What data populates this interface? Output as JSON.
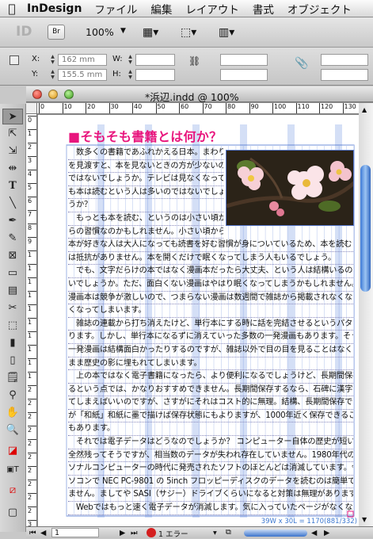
{
  "menubar": {
    "app": "InDesign",
    "items": [
      "ファイル",
      "編集",
      "レイアウト",
      "書式",
      "オブジェクト"
    ]
  },
  "appbar": {
    "br_label": "Br",
    "zoom": "100%"
  },
  "control": {
    "x_label": "X:",
    "x_value": "162 mm",
    "y_label": "Y:",
    "y_value": "155.5 mm",
    "w_label": "W:",
    "h_label": "H:"
  },
  "window": {
    "title": "*浜辺.indd @ 100%"
  },
  "rulers": {
    "h": [
      "0",
      "10",
      "20",
      "30",
      "40",
      "50",
      "60",
      "70",
      "80",
      "90",
      "100",
      "110",
      "120",
      "130"
    ],
    "v": [
      "0",
      "1",
      "2",
      "3",
      "4",
      "5",
      "6",
      "7",
      "8",
      "9",
      "1",
      "1",
      "1",
      "1",
      "1",
      "1",
      "1",
      "1",
      "1",
      "1",
      "2",
      "2",
      "2",
      "2",
      "2",
      "2",
      "2",
      "2",
      "2",
      "2",
      "3"
    ]
  },
  "doc": {
    "heading": "■そもそも書籍とは何か？",
    "lines": [
      "　数多くの書籍であふれかえる日本。まわり",
      "を見渡すと、本を見ないときの方が少ないの",
      "ではないでしょうか。テレビは見なくなって",
      "も本は読むという人は多いのではないでしょ",
      "うか？",
      "　もっとも本を読む、というのは小さい頃か",
      "らの習慣なのかもしれません。小さい頃から",
      "本が好きな人は大人になっても読書を好む習慣が身についているため、本を読むことに",
      "は抵抗がありません。本を開くだけで眠くなってしまう人もいるでしょう。",
      "　でも、文字だらけの本ではなく漫画本だったら大丈夫、という人は結構いるのではな",
      "いでしょうか。ただ、面白くない漫画はやはり眠くなってしまうかもしれません。他社",
      "漫画本は競争が激しいので、つまらない漫画は数週間で雑誌から掲載されなくなってな",
      "くなってしまいます。",
      "　雑誌の連載から打ち消えたけど、単行本にする時に話を完結させるというパターンもあ",
      "ります。しかし、単行本になるずに消えていった多数の一発漫画もあります。そういう",
      "一発漫画は結構面白かったりするのですが、雑誌以外で目の目を見ることはなく、その",
      "まま歴史の影に埋もれてしまいます。",
      "　上の本ではなく電子書籍になったら、より便利になるでしょうけど、長期間保存す",
      "るという点では、かなりおすすめできません。長期間保存するなら、石碑に漢字を描い",
      "てしまえばいいのですが、さすがにそれはコスト的に無理。結構、長期間保存できるの",
      "が「和紙」和紙に墨で描けば保存状態にもよりますが、1000年近く保存できることに",
      "もあります。",
      "　それでは電子データはどうなのでしょうか？ コンピューター自体の歴史が短いので",
      "全然残ってそうですが、相当数のデータが失われ存在していません。1980年代のパー",
      "ソナルコンピューターの時代に発売されたソフトのほとんどは消滅しています。今のパ",
      "ソコンで NEC PC-9801 の 5inch フロッピーディスクのデータを読むのは簡単ではあり",
      "ません。ましてや SASI（サジー）ドライブくらいになると対策は無理があります。",
      "　Webではもっと速く電子データが消滅します。気に入っていたページがなくなって"
    ],
    "counter": "39W x 30L = 1170(881/332)"
  },
  "statusbar": {
    "page": "1",
    "errors": "1 エラー"
  },
  "tools": [
    "selection-tool",
    "direct-selection-tool",
    "page-tool",
    "gap-tool",
    "type-tool",
    "line-tool",
    "pen-tool",
    "pencil-tool",
    "rectangle-frame-tool",
    "rectangle-tool",
    "table-tool",
    "scissors-tool",
    "free-transform-tool",
    "gradient-swatch-tool",
    "gradient-feather-tool",
    "note-tool",
    "eyedropper-tool",
    "hand-tool",
    "zoom-tool",
    "fill-stroke-icon",
    "formatting-icon",
    "apply-none-icon",
    "view-mode-icon"
  ]
}
